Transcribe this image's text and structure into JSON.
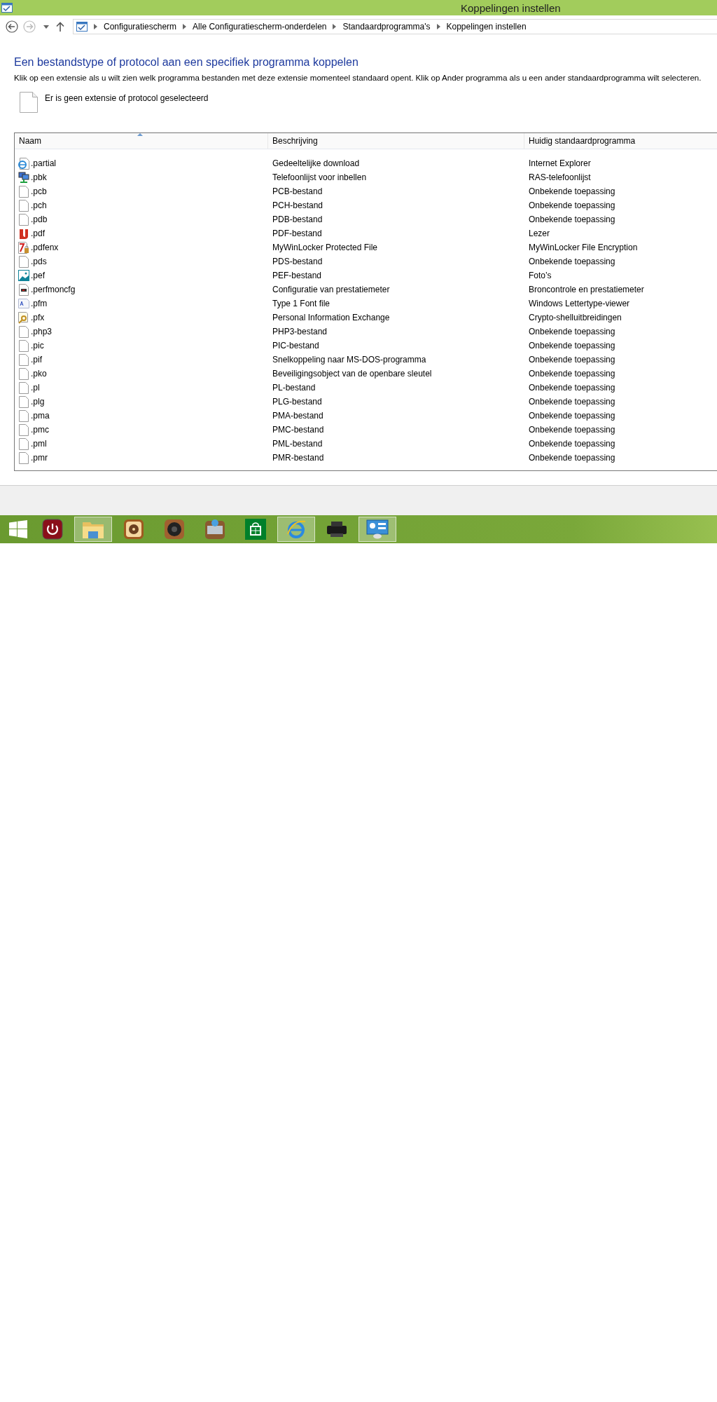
{
  "window": {
    "title": "Koppelingen instellen"
  },
  "nav": {
    "back_disabled": false,
    "forward_disabled": true
  },
  "breadcrumb": [
    "Configuratiescherm",
    "Alle Configuratiescherm-onderdelen",
    "Standaardprogramma's",
    "Koppelingen instellen"
  ],
  "heading": "Een bestandstype of protocol aan een specifiek programma koppelen",
  "description": "Klik op een extensie als u wilt zien welk programma bestanden met deze extensie momenteel standaard opent. Klik op Ander programma als u een ander standaardprogramma wilt selecteren.",
  "selection_info": "Er is geen extensie of protocol geselecteerd",
  "table": {
    "columns": [
      {
        "label": "Naam",
        "sorted": true
      },
      {
        "label": "Beschrijving",
        "sorted": false
      },
      {
        "label": "Huidig standaardprogramma",
        "sorted": false
      }
    ],
    "rows": [
      {
        "kind": "browser",
        "name": ".partial",
        "description": "Gedeeltelijke download",
        "program": "Internet Explorer"
      },
      {
        "kind": "network",
        "name": ".pbk",
        "description": "Telefoonlijst voor inbellen",
        "program": "RAS-telefoonlijst"
      },
      {
        "kind": "file",
        "name": ".pcb",
        "description": "PCB-bestand",
        "program": "Onbekende toepassing"
      },
      {
        "kind": "file",
        "name": ".pch",
        "description": "PCH-bestand",
        "program": "Onbekende toepassing"
      },
      {
        "kind": "file",
        "name": ".pdb",
        "description": "PDB-bestand",
        "program": "Onbekende toepassing"
      },
      {
        "kind": "pdf",
        "name": ".pdf",
        "description": "PDF-bestand",
        "program": "Lezer"
      },
      {
        "kind": "locked-pdf",
        "name": ".pdfenx",
        "description": "MyWinLocker Protected File",
        "program": "MyWinLocker File Encryption"
      },
      {
        "kind": "file",
        "name": ".pds",
        "description": "PDS-bestand",
        "program": "Onbekende toepassing"
      },
      {
        "kind": "image",
        "name": ".pef",
        "description": "PEF-bestand",
        "program": "Foto’s"
      },
      {
        "kind": "monitor",
        "name": ".perfmoncfg",
        "description": "Configuratie van prestatiemeter",
        "program": "Broncontrole en prestatiemeter"
      },
      {
        "kind": "font",
        "name": ".pfm",
        "description": "Type 1 Font file",
        "program": "Windows Lettertype-viewer"
      },
      {
        "kind": "certificate",
        "name": ".pfx",
        "description": "Personal Information Exchange",
        "program": "Crypto-shelluitbreidingen"
      },
      {
        "kind": "file",
        "name": ".php3",
        "description": "PHP3-bestand",
        "program": "Onbekende toepassing"
      },
      {
        "kind": "file",
        "name": ".pic",
        "description": "PIC-bestand",
        "program": "Onbekende toepassing"
      },
      {
        "kind": "file",
        "name": ".pif",
        "description": "Snelkoppeling naar MS-DOS-programma",
        "program": "Onbekende toepassing"
      },
      {
        "kind": "file",
        "name": ".pko",
        "description": "Beveiligingsobject van de openbare sleutel",
        "program": "Onbekende toepassing"
      },
      {
        "kind": "file",
        "name": ".pl",
        "description": "PL-bestand",
        "program": "Onbekende toepassing"
      },
      {
        "kind": "file",
        "name": ".plg",
        "description": "PLG-bestand",
        "program": "Onbekende toepassing"
      },
      {
        "kind": "file",
        "name": ".pma",
        "description": "PMA-bestand",
        "program": "Onbekende toepassing"
      },
      {
        "kind": "file",
        "name": ".pmc",
        "description": "PMC-bestand",
        "program": "Onbekende toepassing"
      },
      {
        "kind": "file",
        "name": ".pml",
        "description": "PML-bestand",
        "program": "Onbekende toepassing"
      },
      {
        "kind": "file",
        "name": ".pmr",
        "description": "PMR-bestand",
        "program": "Onbekende toepassing"
      }
    ]
  },
  "taskbar": [
    {
      "kind": "start",
      "active": false
    },
    {
      "kind": "power",
      "active": false
    },
    {
      "kind": "folder",
      "active": true
    },
    {
      "kind": "media",
      "active": false
    },
    {
      "kind": "speaker",
      "active": false
    },
    {
      "kind": "document",
      "active": false
    },
    {
      "kind": "store",
      "active": false
    },
    {
      "kind": "browser",
      "active": true
    },
    {
      "kind": "printer",
      "active": false
    },
    {
      "kind": "control-panel",
      "active": true
    }
  ]
}
